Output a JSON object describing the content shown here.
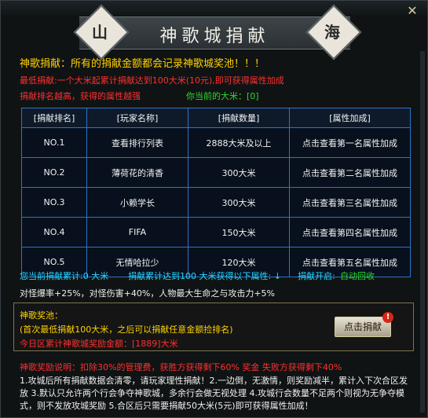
{
  "window": {
    "close_label": "✕"
  },
  "title": {
    "text": "神歌城捐献",
    "left_seal": "山",
    "right_seal": "海"
  },
  "intro": {
    "line1": "神歌捐献：所有的捐献金额都会记录神歌城奖池！！！",
    "line2": "最低捐献:一个大米起累计捐献达到100大米(10元),即可获得属性加成",
    "line3": "捐献排名越高，获得的属性越强",
    "my_rice_label": "你当前的大米：[0]"
  },
  "table": {
    "headers": [
      "[捐献排名]",
      "[玩家名称]",
      "[捐献数量]",
      "[属性加成]"
    ],
    "rows": [
      [
        "NO.1",
        "查看排行列表",
        "2888大米及以上",
        "点击查看第一名属性加成"
      ],
      [
        "NO.2",
        "薄荷花的清香",
        "300大米",
        "点击查看第二名属性加成"
      ],
      [
        "NO.3",
        "小赖学长",
        "300大米",
        "点击查看第三名属性加成"
      ],
      [
        "NO.4",
        "FIFA",
        "150大米",
        "点击查看第四名属性加成"
      ],
      [
        "NO.5",
        "无情哈拉少",
        "120大米",
        "点击查看第五名属性加成"
      ]
    ]
  },
  "status": {
    "line1a": "您当前捐献累计:0 大米",
    "line1b": "捐献累计达到100 大米获得以下属性: ↓",
    "line1c": "捐献开启:",
    "line1d": "自动回收",
    "line2": "对怪爆率+25%，对怪伤害+40%，人物最大生命之与攻击力+5%"
  },
  "pool": {
    "title": "神歌奖池：",
    "note": "(首次最低捐献100大米，之后可以捐献任意金额捡排名)",
    "today": "今日区累计神歌城奖励金额：[1889]大米",
    "button": "点击捐献",
    "badge": "!"
  },
  "rules": {
    "headline": "神歌奖励说明：扣除30%的管理费，获胜方获得剩下60% 奖金 失败方获得剩下40%",
    "body": "1.攻城后所有捐献数据会清零，请玩家理性捐献！2.一边倒，无激情，则奖励减半，累计入下次合区发放 3.默认只允许两个行会争夺神歌城，多余行会做无视处理 4.攻城行会数量不足两个则视为无争夺模式，则不发放攻城奖励 5.合区后只需要捐献50大米(5元)即可获得属性加成！"
  }
}
